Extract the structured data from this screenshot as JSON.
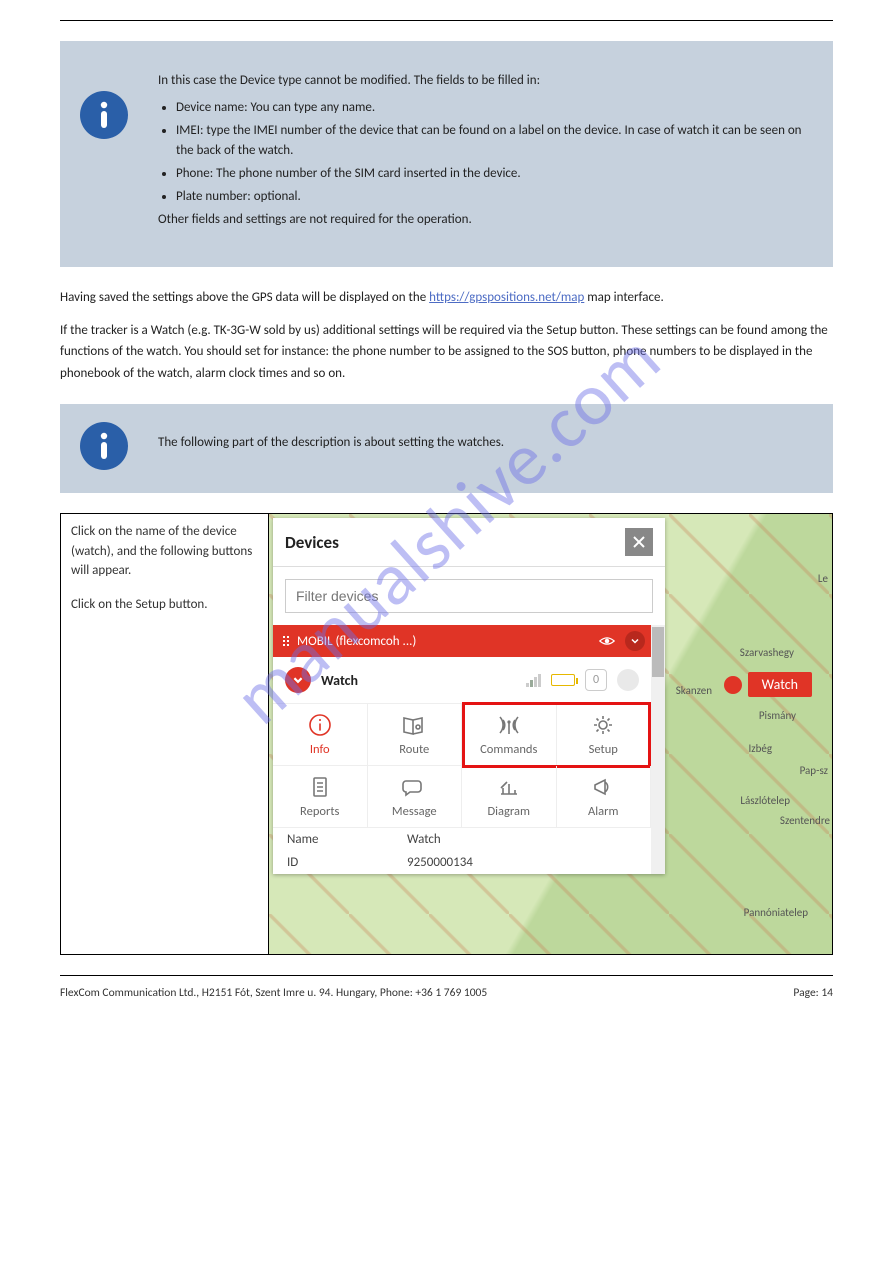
{
  "watermark": "manualshive.com",
  "info_box_1": {
    "intro": "In this case the Device type cannot be modified. The fields to be filled in:",
    "items": [
      "Device name: You can type any name.",
      "IMEI: type the IMEI number of the device that can be found on a label on the device. In case of watch it can be seen on the back of the watch.",
      "Phone: The phone number of the SIM card inserted in the device.",
      "Plate number: optional."
    ],
    "outro": "Other fields and settings are not required for the operation."
  },
  "section1": {
    "p1_prefix": "Having saved the settings above the GPS data will be displayed on the ",
    "p1_link_text": "https://gpspositions.net/map",
    "p1_link_href": "https://gpspositions.net/map",
    "p1_suffix": " map interface.",
    "p2": "If the tracker is a Watch (e.g. TK-3G-W sold by us) additional settings will be required via the Setup button. These settings can be found among the functions of the watch. You should set for instance: the phone number to be assigned to the SOS button, phone numbers to be displayed in the phonebook of the watch, alarm clock times and so on."
  },
  "info_box_2": {
    "text": "The following part of the description is about setting the watches."
  },
  "table_left": {
    "p1": "Click on the name of the device (watch), and the following buttons will appear.",
    "p2": "Click on the Setup button."
  },
  "devices_panel": {
    "title": "Devices",
    "filter_placeholder": "Filter devices",
    "group_label": "MOBIL (flexcomcoh ...)",
    "watch_label": "Watch",
    "count": "0",
    "actions": {
      "info": "Info",
      "route": "Route",
      "commands": "Commands",
      "setup": "Setup",
      "reports": "Reports",
      "message": "Message",
      "diagram": "Diagram",
      "alarm": "Alarm"
    },
    "info_rows": {
      "name_k": "Name",
      "name_v": "Watch",
      "id_k": "ID",
      "id_v": "9250000134"
    }
  },
  "map": {
    "pin_label": "Watch",
    "labels": {
      "szarvashegy": "Szarvashegy",
      "skanzen": "Skanzen",
      "pismany": "Pismány",
      "izbeg": "Izbég",
      "papsz": "Pap-sz",
      "laszlotelep": "Lászlótelep",
      "szentendre": "Szentendre",
      "pannoniatelep": "Pannóniatelep",
      "le": "Le"
    }
  },
  "footer": {
    "left": "FlexCom Communication Ltd., H2151 Fót, Szent Imre u. 94. Hungary, Phone: +36 1 769 1005",
    "right": "Page: 14"
  }
}
